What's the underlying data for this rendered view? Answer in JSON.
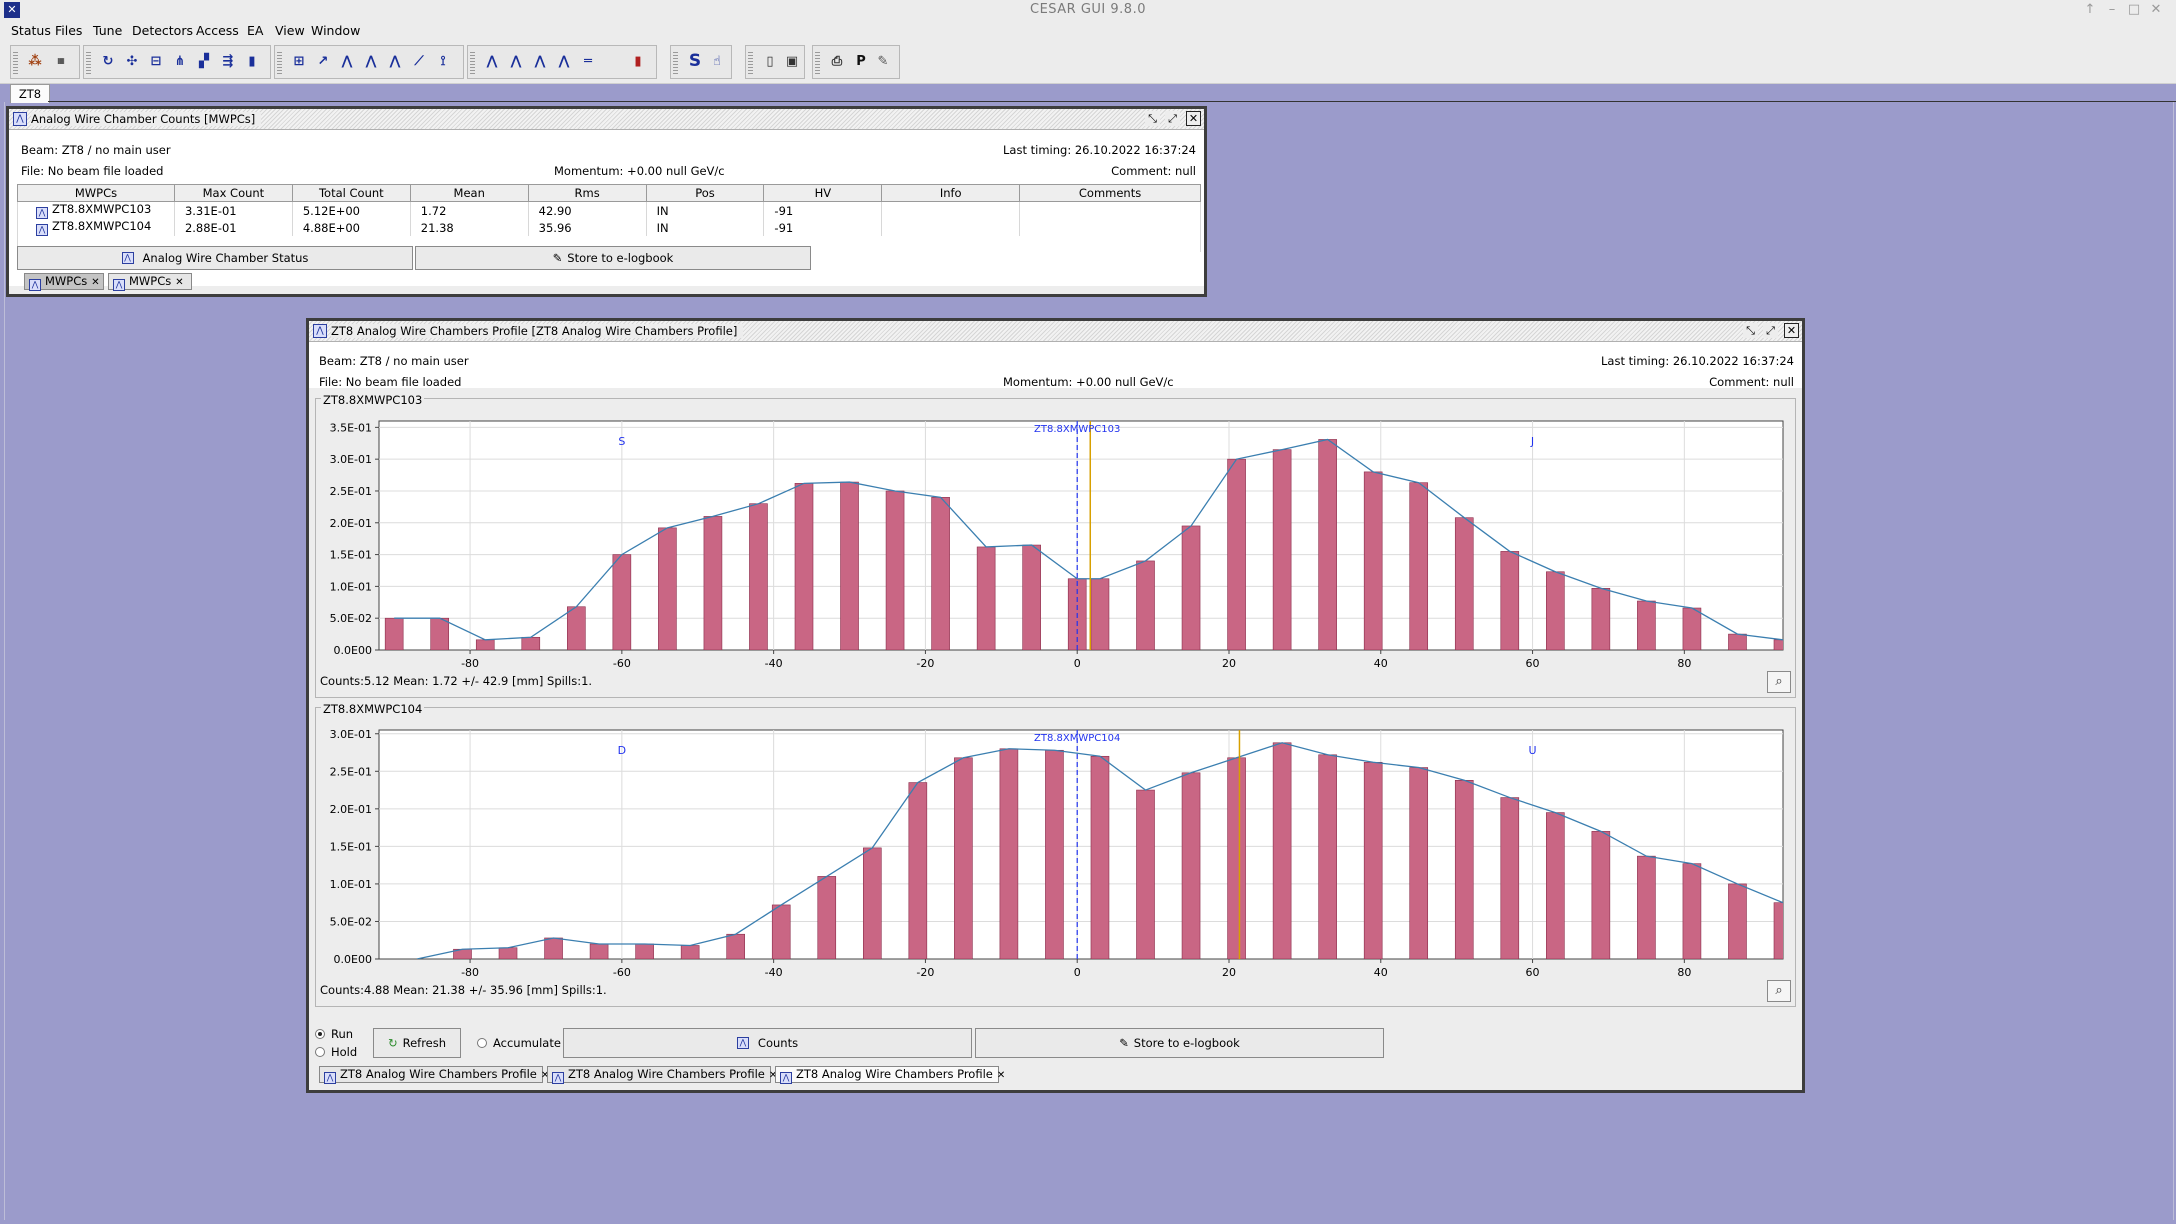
{
  "app": {
    "title": "CESAR GUI  9.8.0",
    "logo": "cesar-logo",
    "controls": [
      "↑",
      "–",
      "□",
      "✕"
    ]
  },
  "menu": [
    "Status",
    "Files",
    "Tune",
    "Detectors",
    "Access",
    "EA",
    "View",
    "Window"
  ],
  "perspective_tab": "ZT8",
  "counts_window": {
    "title": "Analog Wire Chamber Counts [MWPCs]",
    "beam": "Beam: ZT8 / no main user",
    "last_timing": "Last timing: 26.10.2022 16:37:24",
    "file": "File: No beam file loaded",
    "momentum": "Momentum: +0.00 null GeV/c",
    "comment": "Comment: null",
    "columns": [
      "MWPCs",
      "Max Count",
      "Total Count",
      "Mean",
      "Rms",
      "Pos",
      "HV",
      "Info",
      "Comments"
    ],
    "rows": [
      [
        "ZT8.8XMWPC103",
        "3.31E-01",
        "5.12E+00",
        "1.72",
        "42.90",
        "IN",
        "-91",
        "",
        ""
      ],
      [
        "ZT8.8XMWPC104",
        "2.88E-01",
        "4.88E+00",
        "21.38",
        "35.96",
        "IN",
        "-91",
        "",
        ""
      ]
    ],
    "status_button": "Analog Wire Chamber Status",
    "logbook_button": "Store to e-logbook",
    "tabs": [
      "MWPCs",
      "MWPCs"
    ]
  },
  "profile_window": {
    "title": "ZT8 Analog Wire Chambers Profile [ZT8 Analog Wire Chambers Profile]",
    "beam": "Beam: ZT8 / no main user",
    "last_timing": "Last timing: 26.10.2022 16:37:24",
    "file": "File: No beam file loaded",
    "momentum": "Momentum: +0.00 null GeV/c",
    "comment": "Comment: null",
    "run_label": "Run",
    "hold_label": "Hold",
    "refresh_label": "Refresh",
    "accumulate_label": "Accumulate",
    "counts_button": "Counts",
    "logbook_button": "Store to e-logbook",
    "tabs": [
      "ZT8 Analog Wire Chambers Profile",
      "ZT8 Analog Wire Chambers Profile",
      "ZT8 Analog Wire Chambers Profile"
    ]
  },
  "chart_data": [
    {
      "type": "bar",
      "title": "ZT8.8XMWPC103",
      "xlim": [
        -92,
        93
      ],
      "ylim": [
        0,
        0.36
      ],
      "yticks": [
        0,
        0.05,
        0.1,
        0.15,
        0.2,
        0.25,
        0.3,
        0.35
      ],
      "ytick_labels": [
        "0.0E00",
        "5.0E-02",
        "1.0E-01",
        "1.5E-01",
        "2.0E-01",
        "2.5E-01",
        "3.0E-01",
        "3.5E-01"
      ],
      "xticks": [
        -80,
        -60,
        -40,
        -20,
        0,
        20,
        40,
        60,
        80
      ],
      "xtick_labels": [
        "-80",
        "-60",
        "-40",
        "-20",
        "0",
        "20",
        "40",
        "60",
        "80"
      ],
      "x": [
        -90,
        -84,
        -78,
        -72,
        -66,
        -60,
        -54,
        -48,
        -42,
        -36,
        -30,
        -24,
        -18,
        -12,
        -6,
        0,
        3,
        9,
        15,
        21,
        27,
        33,
        39,
        45,
        51,
        57,
        63,
        69,
        75,
        81,
        87,
        93
      ],
      "values": [
        0.05,
        0.05,
        0.016,
        0.02,
        0.068,
        0.15,
        0.192,
        0.21,
        0.23,
        0.262,
        0.264,
        0.25,
        0.24,
        0.162,
        0.165,
        0.112,
        0.112,
        0.14,
        0.195,
        0.3,
        0.315,
        0.331,
        0.28,
        0.263,
        0.208,
        0.155,
        0.123,
        0.097,
        0.077,
        0.066,
        0.025,
        0.016
      ],
      "mean_line": 0,
      "marker_line": 1.72,
      "annotations": [
        {
          "text": "ZT8.8XMWPC103",
          "x": 0
        },
        {
          "text": "S",
          "x": -60
        },
        {
          "text": "J",
          "x": 60
        }
      ],
      "stats": "Counts:5.12   Mean: 1.72 +/- 42.9 [mm]  Spills:1."
    },
    {
      "type": "bar",
      "title": "ZT8.8XMWPC104",
      "xlim": [
        -92,
        93
      ],
      "ylim": [
        0,
        0.305
      ],
      "yticks": [
        0,
        0.05,
        0.1,
        0.15,
        0.2,
        0.25,
        0.3
      ],
      "ytick_labels": [
        "0.0E00",
        "5.0E-02",
        "1.0E-01",
        "1.5E-01",
        "2.0E-01",
        "2.5E-01",
        "3.0E-01"
      ],
      "xticks": [
        -80,
        -60,
        -40,
        -20,
        0,
        20,
        40,
        60,
        80
      ],
      "xtick_labels": [
        "-80",
        "-60",
        "-40",
        "-20",
        "0",
        "20",
        "40",
        "60",
        "80"
      ],
      "x": [
        -87,
        -81,
        -75,
        -69,
        -63,
        -57,
        -51,
        -45,
        -39,
        -33,
        -27,
        -21,
        -15,
        -9,
        -3,
        3,
        9,
        15,
        21,
        27,
        33,
        39,
        45,
        51,
        57,
        63,
        69,
        75,
        81,
        87,
        93
      ],
      "values": [
        0,
        0.013,
        0.015,
        0.028,
        0.02,
        0.02,
        0.018,
        0.033,
        0.072,
        0.11,
        0.148,
        0.235,
        0.268,
        0.28,
        0.278,
        0.27,
        0.225,
        0.248,
        0.268,
        0.288,
        0.272,
        0.262,
        0.255,
        0.238,
        0.215,
        0.195,
        0.17,
        0.137,
        0.127,
        0.1,
        0.075
      ],
      "mean_line": 0,
      "marker_line": 21.38,
      "annotations": [
        {
          "text": "ZT8.8XMWPC104",
          "x": 0
        },
        {
          "text": "D",
          "x": -60
        },
        {
          "text": "U",
          "x": 60
        }
      ],
      "stats": "Counts:4.88   Mean: 21.38 +/- 35.96 [mm]  Spills:1."
    }
  ]
}
